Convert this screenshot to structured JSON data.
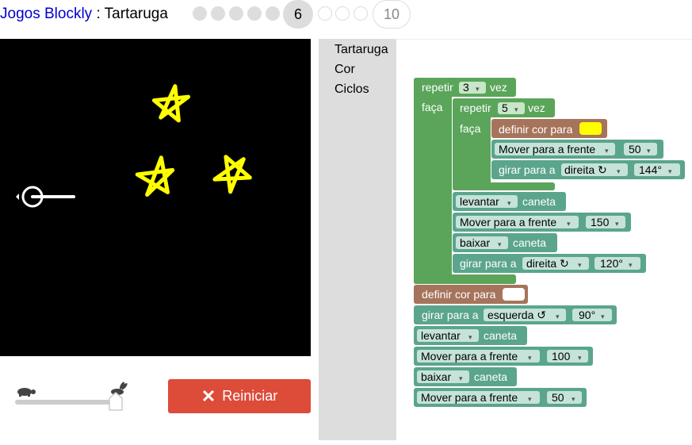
{
  "header": {
    "app_name": "Jogos Blockly",
    "separator": " : ",
    "game_name": "Tartaruga",
    "current_level": "6",
    "last_level": "10"
  },
  "toolbox": {
    "categories": [
      "Tartaruga",
      "Cor",
      "Ciclos"
    ]
  },
  "controls": {
    "reset_label": "Reiniciar",
    "speed_slider_value": 1.0
  },
  "colors": {
    "loop_block": "#5ba55b",
    "turtle_block": "#5ba58c",
    "color_block": "#a5745b",
    "star_color": "#ffff00",
    "reset_button": "#dd4b39"
  },
  "blocks": {
    "outer_repeat": {
      "repeat": "repetir",
      "count": "3",
      "times": "vez",
      "do": "faça"
    },
    "inner_repeat": {
      "repeat": "repetir",
      "count": "5",
      "times": "vez",
      "do": "faça"
    },
    "set_color_1": {
      "label": "definir cor para",
      "color": "#ffff00"
    },
    "move_1": {
      "label": "Mover para a frente",
      "value": "50"
    },
    "turn_1": {
      "label": "girar para a",
      "direction": "direita ↻",
      "value": "144°"
    },
    "pen_up_1": {
      "label": "levantar",
      "suffix": "caneta"
    },
    "move_2": {
      "label": "Mover para a frente",
      "value": "150"
    },
    "pen_down_1": {
      "label": "baixar",
      "suffix": "caneta"
    },
    "turn_2": {
      "label": "girar para a",
      "direction": "direita ↻",
      "value": "120°"
    },
    "set_color_2": {
      "label": "definir cor para",
      "color": "#ffffff"
    },
    "turn_3": {
      "label": "girar para a",
      "direction": "esquerda ↺",
      "value": "90°"
    },
    "pen_up_2": {
      "label": "levantar",
      "suffix": "caneta"
    },
    "move_3": {
      "label": "Mover para a frente",
      "value": "100"
    },
    "pen_down_2": {
      "label": "baixar",
      "suffix": "caneta"
    },
    "move_4": {
      "label": "Mover para a frente",
      "value": "50"
    }
  }
}
